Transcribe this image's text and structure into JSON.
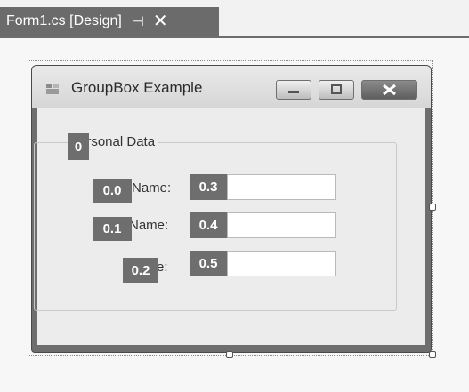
{
  "document_tab": {
    "title": "Form1.cs [Design]",
    "pin_icon": "⊣",
    "close_icon": "✕"
  },
  "form": {
    "title": "GroupBox Example"
  },
  "group": {
    "caption": "ersonal Data"
  },
  "labels": [
    "Name:",
    "Name:",
    "e:"
  ],
  "annotations": [
    "0",
    "0.0",
    "0.1",
    "0.2",
    "0.3",
    "0.4",
    "0.5"
  ],
  "colors": {
    "tag_bg": "#6e6e6e",
    "tab_bg": "#6b6b6b"
  }
}
